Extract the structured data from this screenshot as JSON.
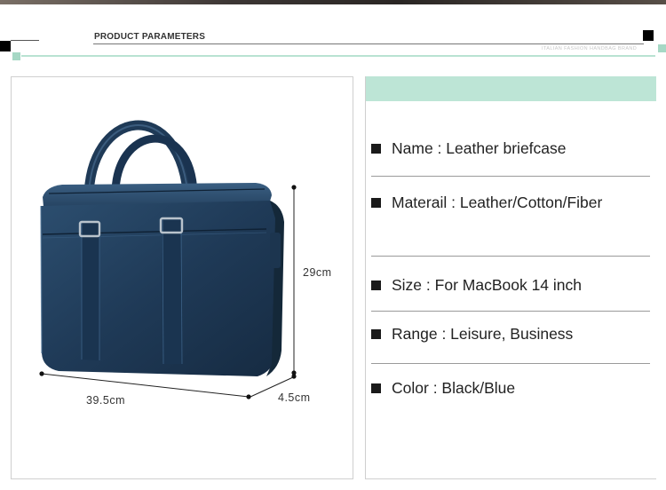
{
  "header": {
    "title": "PRODUCT PARAMETERS",
    "subtitle": "ITALIAN FASHION HANDBAG BRAND"
  },
  "colors": {
    "accent_mint": "#bde5d6",
    "bag_navy": "#1f3a57",
    "text": "#222222"
  },
  "dimensions": {
    "height": "29cm",
    "width": "39.5cm",
    "depth": "4.5cm"
  },
  "specs": [
    {
      "label": "Name",
      "value": "Leather briefcase"
    },
    {
      "label": "Materail",
      "value": "Leather/Cotton/Fiber"
    },
    {
      "label": "Size",
      "value": "For MacBook 14 inch"
    },
    {
      "label": "Range",
      "value": "Leisure, Business"
    },
    {
      "label": "Color",
      "value": "Black/Blue"
    }
  ],
  "product_image": {
    "icon": "leather-briefcase-image"
  }
}
